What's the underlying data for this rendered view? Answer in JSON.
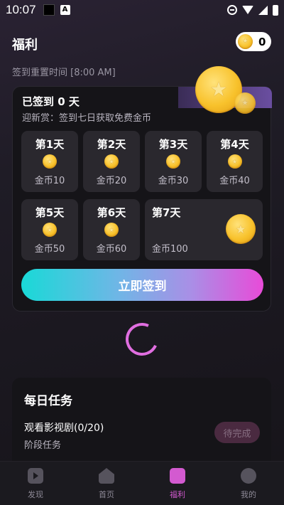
{
  "status": {
    "time": "10:07"
  },
  "header": {
    "title": "福利",
    "coin_count": "0"
  },
  "reset_text": "签到重置时间 [8:00 AM]",
  "checkin": {
    "signed_text": "已签到 0 天",
    "newbie_text": "迎新赏：签到七日获取免费金币",
    "days": [
      {
        "label": "第1天",
        "reward": "金币10"
      },
      {
        "label": "第2天",
        "reward": "金币20"
      },
      {
        "label": "第3天",
        "reward": "金币30"
      },
      {
        "label": "第4天",
        "reward": "金币40"
      },
      {
        "label": "第5天",
        "reward": "金币50"
      },
      {
        "label": "第6天",
        "reward": "金币60"
      },
      {
        "label": "第7天",
        "reward": "金币100"
      }
    ],
    "button_label": "立即签到"
  },
  "tasks": {
    "title": "每日任务",
    "items": [
      {
        "name": "观看影视剧(0/20)",
        "type": "阶段任务",
        "status": "待完成"
      }
    ]
  },
  "tabbar": {
    "items": [
      {
        "label": "发现",
        "icon": "play-video-icon"
      },
      {
        "label": "首页",
        "icon": "home-icon"
      },
      {
        "label": "福利",
        "icon": "gift-icon",
        "active": true
      },
      {
        "label": "我的",
        "icon": "user-icon"
      }
    ]
  },
  "colors": {
    "accent": "#d35ad0",
    "coin": "#f8c22c"
  }
}
